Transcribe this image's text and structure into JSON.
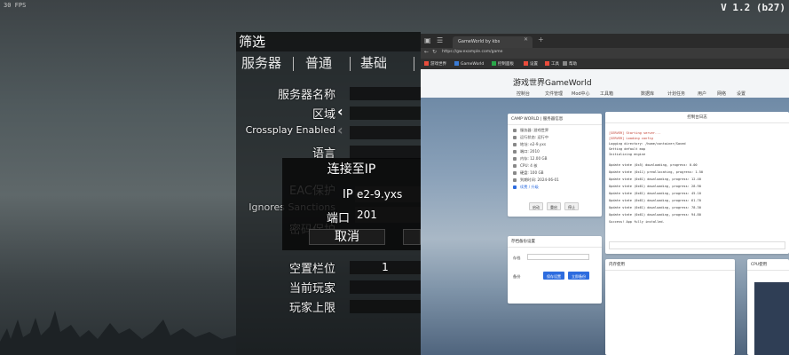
{
  "game": {
    "fps_text": "30 FPS",
    "version": "V 1.2 (b27)"
  },
  "filter_panel": {
    "title": "筛选",
    "tabs": [
      "服务器",
      "普通",
      "基础"
    ],
    "rows": [
      {
        "label": "服务器名称"
      },
      {
        "label": "区域"
      },
      {
        "label": "Crossplay Enabled"
      },
      {
        "label": "语言"
      },
      {
        "label": "EAC保护"
      },
      {
        "label": "Ignores Sanctions"
      },
      {
        "label": "密码保护"
      },
      {
        "label": "空置栏位",
        "value": "1"
      },
      {
        "label": "当前玩家"
      },
      {
        "label": "玩家上限"
      }
    ]
  },
  "connect_dialog": {
    "title": "连接至IP",
    "ip_label": "IP",
    "ip_value": "e2-9.yxs",
    "port_label": "端口",
    "port_value": "201",
    "cancel_label": "取消"
  },
  "browser": {
    "tab_title": "GameWorld by kbs",
    "url": "https://gw.example.com/game",
    "bookmarks": [
      "游戏世界",
      "GameWorld",
      "控制面板",
      "设置",
      "工具",
      "帮助"
    ],
    "site_title": "游戏世界GameWorld",
    "nav": [
      "控制台",
      "文件管理",
      "Mod中心",
      "工具箱",
      "数据库",
      "计划任务",
      "用户",
      "网络",
      "设置"
    ],
    "server_card": {
      "header": "CAMP WORLD | 服务器信息",
      "lines": [
        "服务器: 游戏世界",
        "运行状态: 运行中",
        "地址: e2-9.yxs",
        "端口: 2010",
        "内存: 12.00 GB",
        "CPU: 4 核",
        "硬盘: 100 GB",
        "到期时间: 2024-06-01",
        "续费 / 升级"
      ],
      "buttons": [
        "启动",
        "重启",
        "停止"
      ]
    },
    "backup_card": {
      "header": "存档备份设置",
      "label1": "存档",
      "label2": "备份",
      "buttons": [
        "保存设置",
        "立即备份"
      ]
    },
    "console": {
      "header": "控制台日志",
      "lines": [
        {
          "text": "[SERVER] Starting server...",
          "red": true
        },
        {
          "text": "[SERVER] Loading config",
          "red": true
        },
        {
          "text": "Logging directory: /home/container/Saved",
          "red": false
        },
        {
          "text": "Setting default map",
          "red": false
        },
        {
          "text": "Initializing engine",
          "red": false
        },
        {
          "text": "Update state (0x5) downloading, progress: 0.00",
          "red": false
        },
        {
          "text": "Update state (0x11) preallocating, progress: 1.50",
          "red": false
        },
        {
          "text": "Update state (0x61) downloading, progress: 12.40",
          "red": false
        },
        {
          "text": "Update state (0x61) downloading, progress: 28.90",
          "red": false
        },
        {
          "text": "Update state (0x61) downloading, progress: 45.10",
          "red": false
        },
        {
          "text": "Update state (0x61) downloading, progress: 61.70",
          "red": false
        },
        {
          "text": "Update state (0x61) downloading, progress: 78.30",
          "red": false
        },
        {
          "text": "Update state (0x61) downloading, progress: 94.80",
          "red": false
        },
        {
          "text": "Success! App fully installed.",
          "red": false
        }
      ]
    },
    "bottom_cards": [
      "内存使用",
      "CPU使用"
    ]
  }
}
